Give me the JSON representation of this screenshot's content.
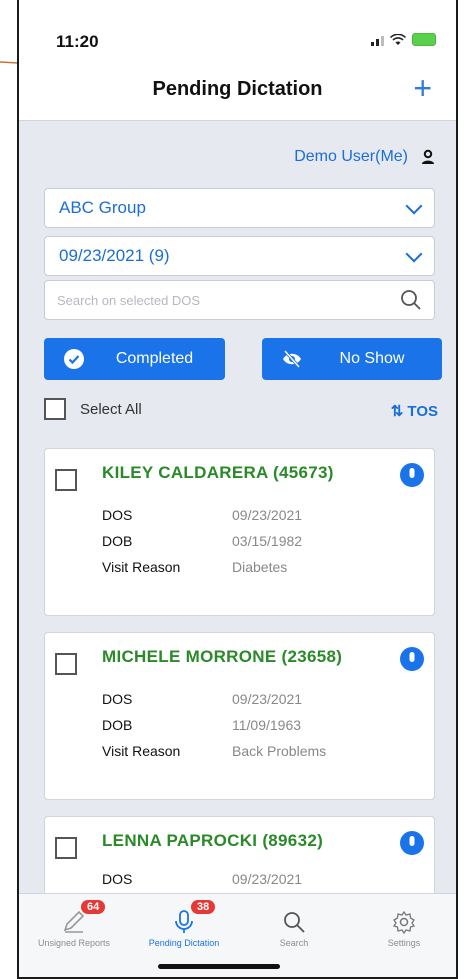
{
  "status": {
    "time": "11:20"
  },
  "header": {
    "title": "Pending Dictation",
    "add_label": "+"
  },
  "user": {
    "name": "Demo User(Me)"
  },
  "filters": {
    "group": "ABC Group",
    "date": "09/23/2021 (9)",
    "search_placeholder": "Search on selected DOS"
  },
  "actions": {
    "completed": "Completed",
    "no_show": "No Show"
  },
  "list_controls": {
    "select_all": "Select All",
    "sort": "⇅ TOS"
  },
  "labels": {
    "dos": "DOS",
    "dob": "DOB",
    "visit_reason": "Visit Reason"
  },
  "patients": [
    {
      "name": "KILEY CALDARERA (45673)",
      "dos": "09/23/2021",
      "dob": "03/15/1982",
      "reason": "Diabetes"
    },
    {
      "name": "MICHELE MORRONE (23658)",
      "dos": "09/23/2021",
      "dob": "11/09/1963",
      "reason": "Back Problems"
    },
    {
      "name": "LENNA PAPROCKI (89632)",
      "dos": "09/23/2021"
    }
  ],
  "tabs": [
    {
      "label": "Unsigned Reports",
      "badge": "64",
      "icon": "pen-icon"
    },
    {
      "label": "Pending Dictation",
      "badge": "38",
      "icon": "microphone-icon"
    },
    {
      "label": "Search",
      "icon": "search-icon"
    },
    {
      "label": "Settings",
      "icon": "gear-icon"
    }
  ],
  "colors": {
    "accent": "#1a73e8",
    "patient_name": "#2a8a2a",
    "badge": "#e53935"
  }
}
